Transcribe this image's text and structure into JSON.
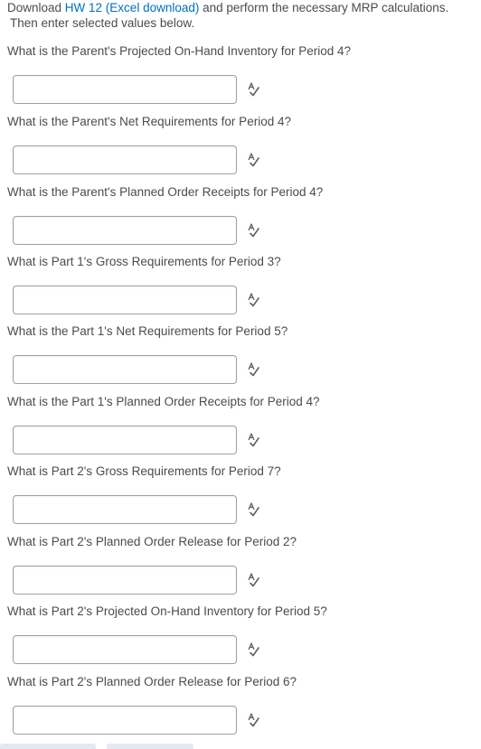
{
  "intro": {
    "before_link": "Download ",
    "link_text": "HW 12 (Excel download)",
    "after_link": " and perform the necessary MRP calculations.",
    "line2": "Then enter selected values below."
  },
  "questions": [
    {
      "text": "What is the Parent's Projected On-Hand Inventory for Period 4?",
      "value": ""
    },
    {
      "text": "What is the Parent's Net Requirements for Period 4?",
      "value": ""
    },
    {
      "text": "What is the Parent's Planned Order Receipts for Period 4?",
      "value": ""
    },
    {
      "text": "What is Part 1's Gross Requirements for Period 3?",
      "value": ""
    },
    {
      "text": "What is the Part 1's Net Requirements for Period 5?",
      "value": ""
    },
    {
      "text": "What is the Part 1's Planned Order Receipts for Period 4?",
      "value": ""
    },
    {
      "text": "What is Part 2's Gross Requirements for Period 7?",
      "value": ""
    },
    {
      "text": "What is Part 2's Planned Order Release for Period 2?",
      "value": ""
    },
    {
      "text": "What is Part 2's Projected On-Hand Inventory for Period 5?",
      "value": ""
    },
    {
      "text": "What is Part 2's Planned Order Release for Period 6?",
      "value": ""
    }
  ],
  "icons": {
    "answer_tool": "spell-check-icon"
  },
  "colors": {
    "text": "#494c4e",
    "link": "#006fbf",
    "input_border": "#9ca0a4"
  }
}
